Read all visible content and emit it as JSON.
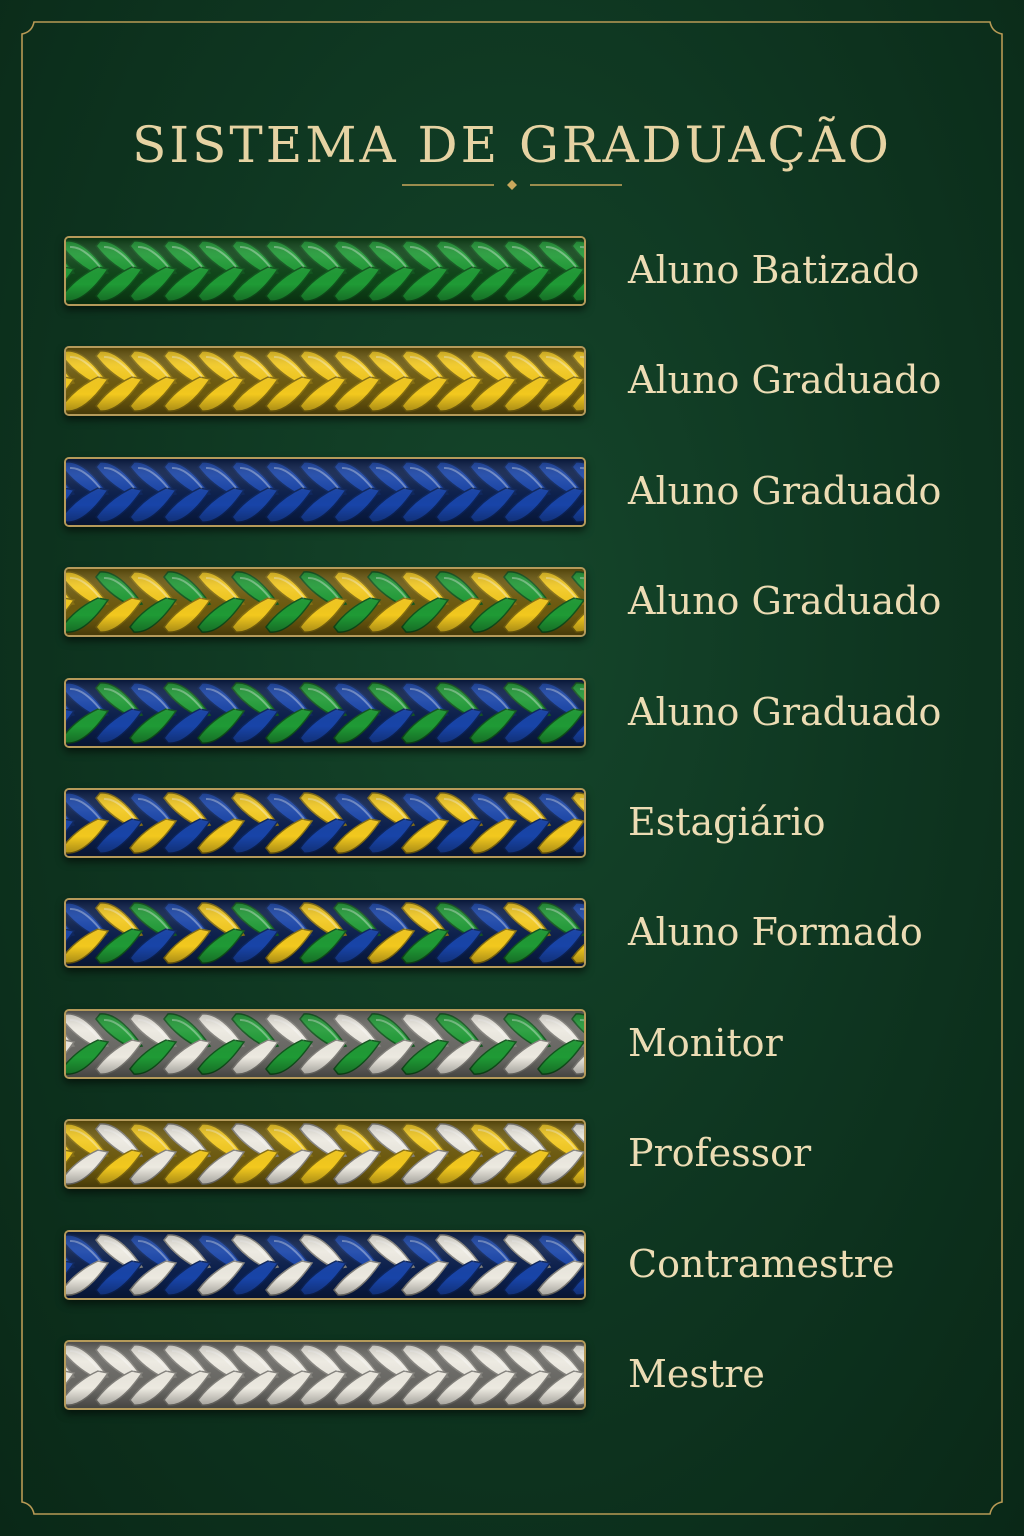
{
  "title": "SISTEMA DE GRADUAÇÃO",
  "colors": {
    "background": "#0f3520",
    "gold": "#c9a85c",
    "text": "#ecdcb4",
    "green": "#1f9a35",
    "yellow": "#f2c81e",
    "blue": "#1844a8",
    "white": "#ece9e0"
  },
  "ranks": [
    {
      "label": "Aluno Batizado",
      "cord_colors": [
        "#1f9a35",
        "#1f9a35"
      ]
    },
    {
      "label": "Aluno Graduado",
      "cord_colors": [
        "#f2c81e",
        "#f2c81e"
      ]
    },
    {
      "label": "Aluno Graduado",
      "cord_colors": [
        "#1844a8",
        "#1844a8"
      ]
    },
    {
      "label": "Aluno Graduado",
      "cord_colors": [
        "#f2c81e",
        "#1f9a35"
      ]
    },
    {
      "label": "Aluno Graduado",
      "cord_colors": [
        "#1844a8",
        "#1f9a35"
      ]
    },
    {
      "label": "Estagiário",
      "cord_colors": [
        "#1844a8",
        "#f2c81e"
      ]
    },
    {
      "label": "Aluno Formado",
      "cord_colors": [
        "#1844a8",
        "#f2c81e",
        "#1f9a35"
      ]
    },
    {
      "label": "Monitor",
      "cord_colors": [
        "#ece9e0",
        "#1f9a35"
      ]
    },
    {
      "label": "Professor",
      "cord_colors": [
        "#f2c81e",
        "#ece9e0"
      ]
    },
    {
      "label": "Contramestre",
      "cord_colors": [
        "#1844a8",
        "#ece9e0"
      ]
    },
    {
      "label": "Mestre",
      "cord_colors": [
        "#ece9e0",
        "#ece9e0"
      ]
    }
  ]
}
